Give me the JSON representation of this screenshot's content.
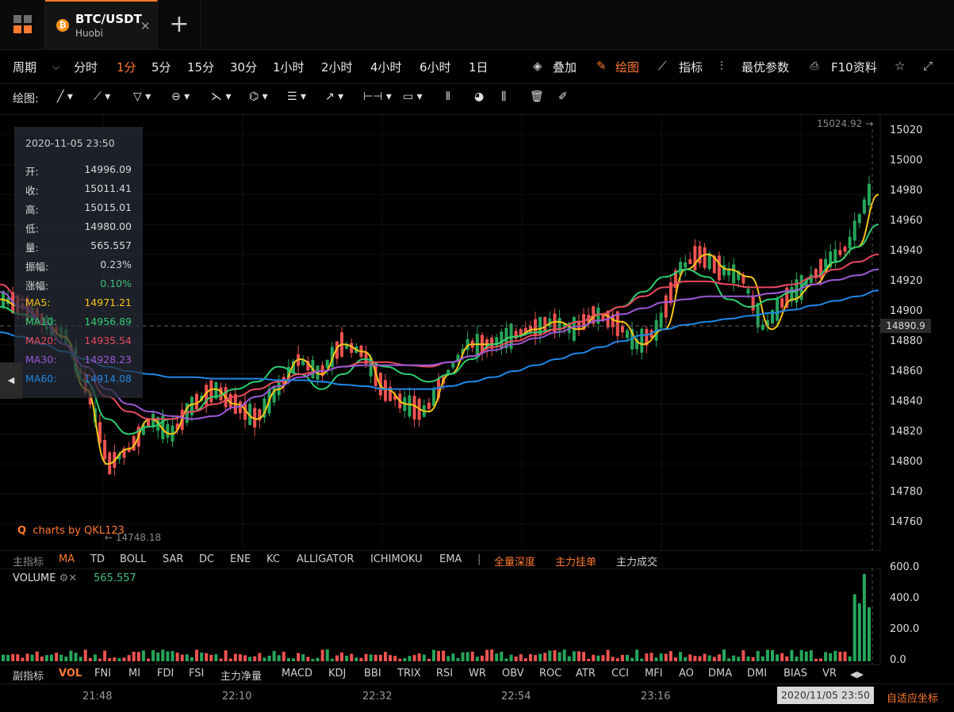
{
  "tab": {
    "symbol_icon": "bitcoin-icon",
    "coin_glyph": "₿",
    "pair": "BTC/USDT",
    "exchange": "Huobi",
    "close_glyph": "✕",
    "add_glyph": "+"
  },
  "toolbar": {
    "period_label": "周期",
    "periods": [
      "分时",
      "1分",
      "5分",
      "15分",
      "30分",
      "1小时",
      "2小时",
      "4小时",
      "6小时",
      "1日"
    ],
    "active_period": "1分",
    "overlay": "叠加",
    "draw": "绘图",
    "indicator": "指标",
    "best_params": "最优参数",
    "f10": "F10资料"
  },
  "drawing": {
    "label": "绘图:"
  },
  "info_panel": {
    "datetime": "2020-11-05 23:50",
    "rows": [
      {
        "label": "开:",
        "value": "14996.09"
      },
      {
        "label": "收:",
        "value": "15011.41"
      },
      {
        "label": "高:",
        "value": "15015.01"
      },
      {
        "label": "低:",
        "value": "14980.00"
      },
      {
        "label": "量:",
        "value": "565.557"
      },
      {
        "label": "振幅:",
        "value": "0.23%"
      },
      {
        "label": "涨幅:",
        "value": "0.10%"
      }
    ],
    "ma": [
      {
        "label": "MA5:",
        "value": "14971.21",
        "color": "#f5c518"
      },
      {
        "label": "MA10:",
        "value": "14956.89",
        "color": "#2ecc71"
      },
      {
        "label": "MA20:",
        "value": "14935.54",
        "color": "#e84a5f"
      },
      {
        "label": "MA30:",
        "value": "14928.23",
        "color": "#9b59d6"
      },
      {
        "label": "MA60:",
        "value": "14914.08",
        "color": "#1e88e5"
      }
    ]
  },
  "watermark": "charts by QKL123",
  "low_marker": "← 14748.18",
  "high_marker": "15024.92 →",
  "current_price": "14890.9",
  "price_axis": [
    "15020",
    "15000",
    "14980",
    "14960",
    "14940",
    "14920",
    "14900",
    "14880",
    "14860",
    "14840",
    "14820",
    "14800",
    "14780",
    "14760"
  ],
  "main_indicators": {
    "label": "主指标",
    "items": [
      "MA",
      "TD",
      "BOLL",
      "SAR",
      "DC",
      "ENE",
      "KC",
      "ALLIGATOR",
      "ICHIMOKU",
      "EMA"
    ],
    "active": "MA",
    "extra": [
      "全量深度",
      "主力挂单",
      "主力成交"
    ]
  },
  "volume": {
    "title": "VOLUME",
    "value": "565.557",
    "axis": [
      "600.0",
      "400.0",
      "200.0",
      "0.0"
    ]
  },
  "sub_indicators": {
    "label": "副指标",
    "items": [
      "VOL",
      "FNI",
      "MI",
      "FDI",
      "FSI",
      "主力净量",
      "MACD",
      "KDJ",
      "BBI",
      "TRIX",
      "RSI",
      "WR",
      "OBV",
      "ROC",
      "ATR",
      "CCI",
      "MFI",
      "AO",
      "DMA",
      "DMI",
      "BIAS",
      "VR"
    ],
    "active": "VOL"
  },
  "time_axis": [
    "21:48",
    "22:10",
    "22:32",
    "22:54",
    "23:16"
  ],
  "time_cursor": "2020/11/05 23:50",
  "auto_axis": "自适应坐标",
  "colors": {
    "up": "#26a65b",
    "down": "#ef5350",
    "accent": "#ff7a2e"
  },
  "chart_data": {
    "type": "candlestick",
    "ylim": [
      14745,
      15030
    ],
    "ma_key_points": {
      "ma5": [
        14910,
        14905,
        14895,
        14885,
        14850,
        14800,
        14810,
        14830,
        14820,
        14840,
        14850,
        14840,
        14830,
        14850,
        14870,
        14860,
        14880,
        14875,
        14850,
        14840,
        14835,
        14860,
        14880,
        14880,
        14885,
        14890,
        14895,
        14890,
        14900,
        14895,
        14880,
        14890,
        14930,
        14940,
        14930,
        14925,
        14890,
        14910,
        14920,
        14935,
        14945,
        14980
      ],
      "ma10": [
        14905,
        14900,
        14895,
        14880,
        14855,
        14830,
        14820,
        14825,
        14830,
        14835,
        14845,
        14850,
        14855,
        14865,
        14860,
        14850,
        14860,
        14870,
        14865,
        14860,
        14855,
        14860,
        14870,
        14880,
        14885,
        14888,
        14890,
        14895,
        14900,
        14905,
        14915,
        14925,
        14930,
        14925,
        14910,
        14905,
        14910,
        14915,
        14925,
        14935,
        14945,
        14960
      ],
      "ma20": [
        14920,
        14910,
        14895,
        14880,
        14860,
        14845,
        14835,
        14830,
        14830,
        14835,
        14840,
        14845,
        14850,
        14855,
        14860,
        14862,
        14865,
        14868,
        14868,
        14866,
        14865,
        14868,
        14872,
        14878,
        14882,
        14886,
        14890,
        14895,
        14900,
        14905,
        14912,
        14918,
        14922,
        14922,
        14920,
        14918,
        14918,
        14920,
        14925,
        14930,
        14935,
        14940
      ],
      "ma30": [
        14915,
        14905,
        14895,
        14880,
        14865,
        14850,
        14840,
        14835,
        14832,
        14830,
        14832,
        14838,
        14845,
        14852,
        14858,
        14862,
        14865,
        14866,
        14866,
        14866,
        14866,
        14868,
        14872,
        14876,
        14880,
        14884,
        14888,
        14892,
        14896,
        14900,
        14904,
        14908,
        14910,
        14912,
        14912,
        14912,
        14914,
        14916,
        14920,
        14923,
        14926,
        14930
      ],
      "ma60": [
        14888,
        14885,
        14880,
        14875,
        14870,
        14865,
        14862,
        14860,
        14858,
        14858,
        14857,
        14857,
        14857,
        14856,
        14856,
        14855,
        14853,
        14852,
        14850,
        14850,
        14850,
        14852,
        14855,
        14858,
        14862,
        14866,
        14870,
        14874,
        14878,
        14882,
        14886,
        14890,
        14893,
        14895,
        14897,
        14899,
        14901,
        14903,
        14906,
        14909,
        14912,
        14916
      ]
    }
  }
}
